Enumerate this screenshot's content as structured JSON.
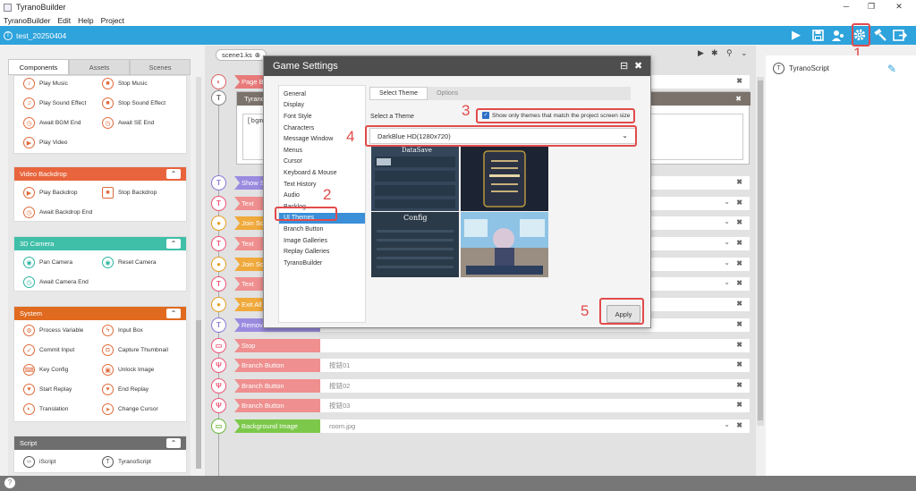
{
  "window": {
    "title": "TyranoBuilder"
  },
  "menu": [
    "TyranoBuilder",
    "Edit",
    "Help",
    "Project"
  ],
  "project": {
    "name": "test_20250404"
  },
  "left_tabs": [
    "Components",
    "Assets",
    "Scenes"
  ],
  "groups": {
    "audio": {
      "items": [
        "Play Music",
        "Stop Music",
        "Play Sound Effect",
        "Stop Sound Effect",
        "Await BGM End",
        "Await SE End",
        "Play Video"
      ]
    },
    "video": {
      "title": "Video Backdrop",
      "items": [
        "Play Backdrop",
        "Stop Backdrop",
        "Await Backdrop End"
      ]
    },
    "camera": {
      "title": "3D Camera",
      "items": [
        "Pan Camera",
        "Reset Camera",
        "Await Camera End"
      ]
    },
    "system": {
      "title": "System",
      "items": [
        "Process Variable",
        "Input Box",
        "Commit Input",
        "Capture Thumbnail",
        "Key Config",
        "Unlock Image",
        "Start Replay",
        "End Replay",
        "Translation",
        "Change Cursor"
      ]
    },
    "script": {
      "title": "Script",
      "items": [
        "iScript",
        "TyranoScript"
      ]
    }
  },
  "editor": {
    "scene_tab": "scene1.ks",
    "script_header": "Tyrano",
    "script_text": "[bgm",
    "rows": [
      {
        "label": "Page B",
        "param": ""
      },
      {
        "label": "Show S",
        "param": ""
      },
      {
        "label": "Text",
        "param": ""
      },
      {
        "label": "Join Sc",
        "param": ""
      },
      {
        "label": "Text",
        "param": ""
      },
      {
        "label": "Join Sc",
        "param": ""
      },
      {
        "label": "Text",
        "param": ""
      },
      {
        "label": "Exit All",
        "param": ""
      },
      {
        "label": "Remov",
        "param": ""
      },
      {
        "label": "Stop",
        "param": ""
      },
      {
        "label": "Branch Button",
        "param": "按鈕01"
      },
      {
        "label": "Branch Button",
        "param": "按鈕02"
      },
      {
        "label": "Branch Button",
        "param": "按鈕03"
      },
      {
        "label": "Background Image",
        "param": "room.jpg"
      }
    ]
  },
  "right_panel": {
    "item": "TyranoScript"
  },
  "dialog": {
    "title": "Game Settings",
    "categories": [
      "General",
      "Display",
      "Font Style",
      "Characters",
      "Message Window",
      "Menus",
      "Cursor",
      "Keyboard & Mouse",
      "Text History",
      "Audio",
      "Backlog",
      "UI Themes",
      "Branch Button",
      "Image Galleries",
      "Replay Galleries",
      "TyranoBuilder"
    ],
    "tabs": [
      "Select Theme",
      "Options"
    ],
    "select_label": "Select a Theme",
    "checkbox_label": "Show only themes that match the project screen size",
    "selected_theme": "DarkBlue HD(1280x720)",
    "apply_label": "Apply",
    "thumbs": {
      "datasave": "DataSave",
      "config": "Config"
    }
  },
  "annotations": [
    "1",
    "2",
    "3",
    "4",
    "5"
  ],
  "colors": {
    "accent": "#2ea3dc",
    "highlight": "#e24b4b",
    "audio": "#e06a3a",
    "camera": "#3fbfa8",
    "system": "#e06a1f",
    "script": "#6e6e6e"
  }
}
